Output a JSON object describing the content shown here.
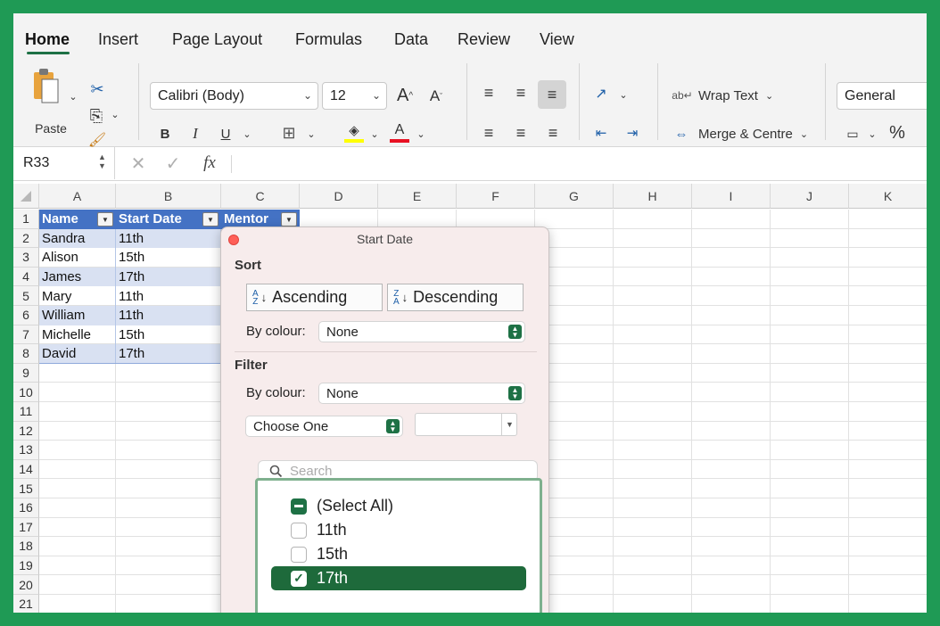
{
  "tabs": [
    "Home",
    "Insert",
    "Page Layout",
    "Formulas",
    "Data",
    "Review",
    "View"
  ],
  "ribbon": {
    "paste_label": "Paste",
    "font_name": "Calibri (Body)",
    "font_size": "12",
    "wrap_text": "Wrap Text",
    "merge_centre": "Merge & Centre",
    "number_format": "General"
  },
  "formula_bar": {
    "name_box": "R33",
    "fx": "fx",
    "formula": ""
  },
  "grid": {
    "columns": [
      "A",
      "B",
      "C",
      "D",
      "E",
      "F",
      "G",
      "H",
      "I",
      "J",
      "K"
    ],
    "rows": [
      "1",
      "2",
      "3",
      "4",
      "5",
      "6",
      "7",
      "8",
      "9",
      "10",
      "11",
      "12",
      "13",
      "14",
      "15",
      "16",
      "17",
      "18",
      "19",
      "20",
      "21"
    ],
    "headers": [
      "Name",
      "Start Date",
      "Mentor"
    ],
    "data": [
      [
        "Sandra",
        "11th"
      ],
      [
        "Alison",
        "15th"
      ],
      [
        "James",
        "17th"
      ],
      [
        "Mary",
        "11th"
      ],
      [
        "William",
        "11th"
      ],
      [
        "Michelle",
        "15th"
      ],
      [
        "David",
        "17th"
      ]
    ]
  },
  "filter_dialog": {
    "title": "Start Date",
    "sort_label": "Sort",
    "ascending": "Ascending",
    "descending": "Descending",
    "by_colour_label": "By colour:",
    "sort_by_colour": "None",
    "filter_label": "Filter",
    "filter_by_colour": "None",
    "choose_one": "Choose One",
    "search_placeholder": "Search",
    "items": [
      {
        "label": "(Select All)",
        "state": "mixed"
      },
      {
        "label": "11th",
        "state": "unchecked"
      },
      {
        "label": "15th",
        "state": "unchecked"
      },
      {
        "label": "17th",
        "state": "checked"
      }
    ]
  },
  "colors": {
    "accent": "#1e7145",
    "frame": "#1f9a55",
    "table_header": "#4472c4",
    "table_band": "#d9e1f2",
    "highlight_bar": "#ffff00",
    "font_color_bar": "#e81123"
  }
}
